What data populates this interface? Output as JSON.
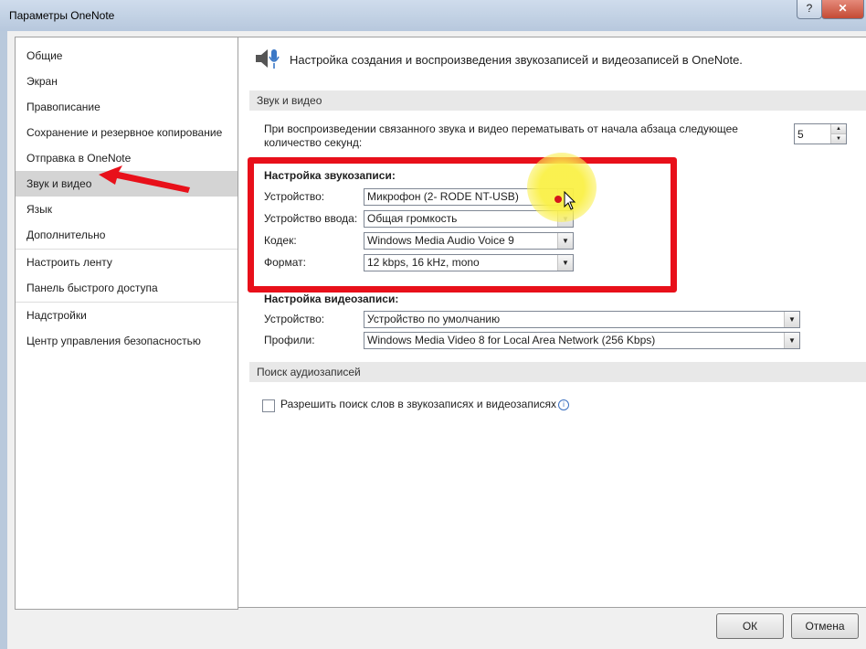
{
  "window": {
    "title": "Параметры OneNote",
    "help_label": "?",
    "close_label": "✕"
  },
  "sidebar": {
    "items": [
      {
        "label": "Общие"
      },
      {
        "label": "Экран"
      },
      {
        "label": "Правописание"
      },
      {
        "label": "Сохранение и резервное копирование"
      },
      {
        "label": "Отправка в OneNote"
      },
      {
        "label": "Звук и видео",
        "selected": true
      },
      {
        "label": "Язык"
      },
      {
        "label": "Дополнительно"
      },
      {
        "label": "Настроить ленту"
      },
      {
        "label": "Панель быстрого доступа"
      },
      {
        "label": "Надстройки"
      },
      {
        "label": "Центр управления безопасностью"
      }
    ]
  },
  "main": {
    "header_text": "Настройка создания и воспроизведения звукозаписей и видеозаписей в OneNote.",
    "section_av": "Звук и видео",
    "rewind_text_line1": "При воспроизведении связанного звука и видео перематывать от начала абзаца следующее",
    "rewind_text_line2": "количество секунд:",
    "rewind_value": "5",
    "audio": {
      "heading": "Настройка звукозаписи:",
      "device_label": "Устройство:",
      "device_value": "Микрофон (2- RODE NT-USB)",
      "input_label": "Устройство ввода:",
      "input_value": "Общая громкость",
      "codec_label": "Кодек:",
      "codec_value": "Windows Media Audio Voice 9",
      "format_label": "Формат:",
      "format_value": "12 kbps, 16 kHz, mono"
    },
    "video": {
      "heading": "Настройка видеозаписи:",
      "device_label": "Устройство:",
      "device_value": "Устройство по умолчанию",
      "profile_label": "Профили:",
      "profile_value": "Windows Media Video 8 for Local Area Network (256 Kbps)"
    },
    "section_search": "Поиск аудиозаписей",
    "search_checkbox_label": "Разрешить поиск слов в звукозаписях и видеозаписях",
    "info_icon": "i"
  },
  "footer": {
    "ok_label": "ОК",
    "cancel_label": "Отмена"
  },
  "colors": {
    "annotation_red": "#e8101a",
    "highlight_yellow": "#f7ef4a",
    "selected_nav": "#d4d4d4"
  },
  "icons": [
    "speaker-microphone-icon",
    "red-arrow-annotation",
    "mouse-cursor-icon",
    "info-icon",
    "dropdown-arrow-icon"
  ]
}
